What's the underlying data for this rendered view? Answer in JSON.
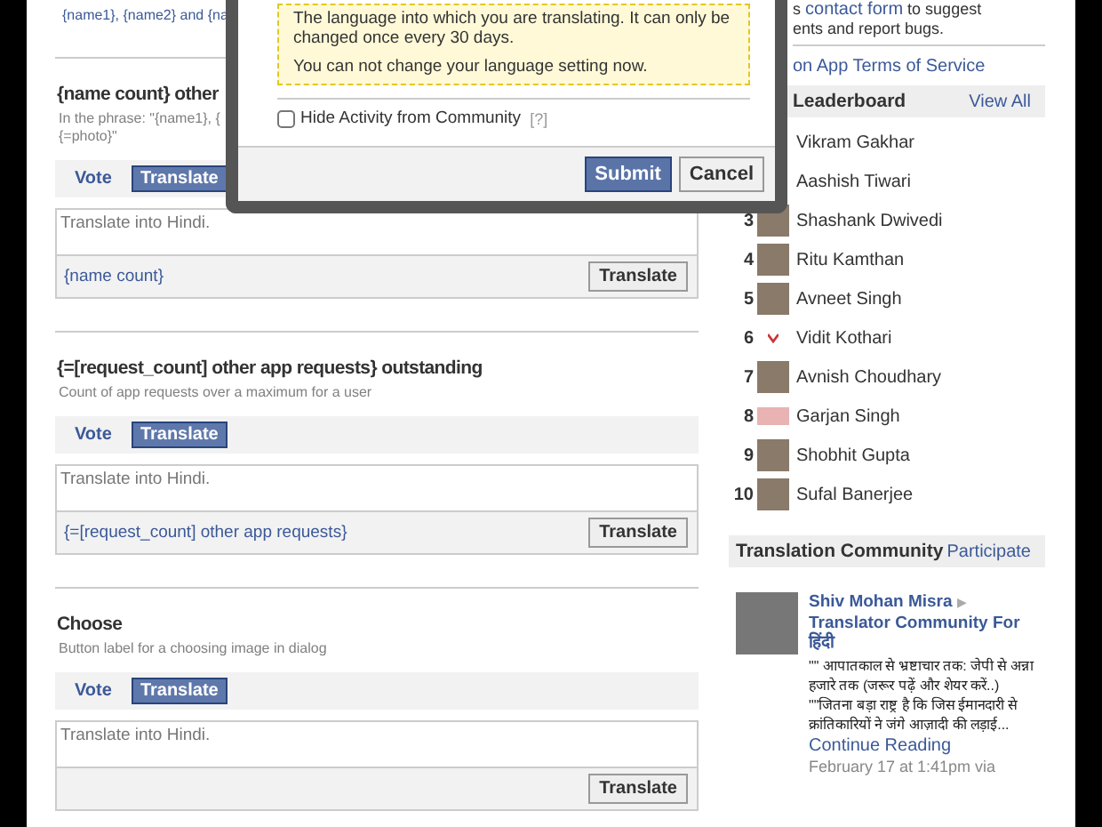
{
  "main": {
    "top_snippet": "{name1}, {name2} and {na",
    "sections": [
      {
        "title": "{name count} other",
        "description": "In the phrase: \"{name1}, {\n{=photo}\"",
        "tabs": [
          {
            "label": "Vote",
            "selected": false
          },
          {
            "label": "Translate",
            "selected": true
          }
        ],
        "input": {
          "placeholder": "Translate into Hindi."
        },
        "source": "{name count}",
        "button": "Translate"
      },
      {
        "title": "{=[request_count] other app requests} outstanding",
        "description": "Count of app requests over a maximum for a user",
        "tabs": [
          {
            "label": "Vote",
            "selected": false
          },
          {
            "label": "Translate",
            "selected": true
          }
        ],
        "input": {
          "placeholder": "Translate into Hindi."
        },
        "source": "{=[request_count] other app requests}",
        "button": "Translate"
      },
      {
        "title": "Choose",
        "description": "Button label for a choosing image in dialog",
        "tabs": [
          {
            "label": "Vote",
            "selected": false
          },
          {
            "label": "Translate",
            "selected": true
          }
        ],
        "input": {
          "placeholder": "Translate into Hindi."
        },
        "button": "Translate"
      }
    ]
  },
  "sidebar": {
    "feedback": {
      "before": "s",
      "link": "contact form",
      "after": "to suggest",
      "line2": "ents and report bugs."
    },
    "terms_link": "on App Terms of Service",
    "leaderboard": {
      "title": "Leaderboard",
      "action": "View All",
      "entries": [
        {
          "name": "Vikram Gakhar"
        },
        {
          "name": "Aashish Tiwari"
        },
        {
          "rank": "3",
          "name": "Shashank Dwivedi",
          "kind": "photo"
        },
        {
          "rank": "4",
          "name": "Ritu Kamthan",
          "kind": "photo"
        },
        {
          "rank": "5",
          "name": "Avneet Singh",
          "kind": "photo"
        },
        {
          "rank": "6",
          "name": "Vidit Kothari",
          "kind": "mark"
        },
        {
          "rank": "7",
          "name": "Avnish Choudhary",
          "kind": "photo"
        },
        {
          "rank": "8",
          "name": "Garjan Singh",
          "kind": "logo"
        },
        {
          "rank": "9",
          "name": "Shobhit Gupta",
          "kind": "photo"
        },
        {
          "rank": "10",
          "name": "Sufal Banerjee",
          "kind": "photo"
        }
      ]
    },
    "community": {
      "title": "Translation Community",
      "action": "Participate",
      "post": {
        "author": "Shiv Mohan Misra",
        "arrow": "▶",
        "target": "Translator Community For हिंदी",
        "body": "\"\" आपातकाल से भ्रष्टाचार तक: जेपी से अन्ना हजारे तक (जरूर पढ़ें और शेयर करें..) \"\"जितना बड़ा राष्ट्र है कि जिस ईमानदारी से क्रांतिकारियों ने जंगे आज़ादी की लड़ाई...",
        "more": "Continue Reading",
        "meta": "February 17 at 1:41pm via"
      }
    }
  },
  "dialog": {
    "notices": [
      "The language into which you are translating. It can only be changed once every 30 days.",
      "You can not change your language setting now."
    ],
    "checkbox": {
      "label": "Hide Activity from Community",
      "checked": false
    },
    "help": "[?]",
    "buttons": [
      {
        "label": "Submit",
        "kind": "primary"
      },
      {
        "label": "Cancel",
        "kind": "secondary"
      }
    ]
  }
}
